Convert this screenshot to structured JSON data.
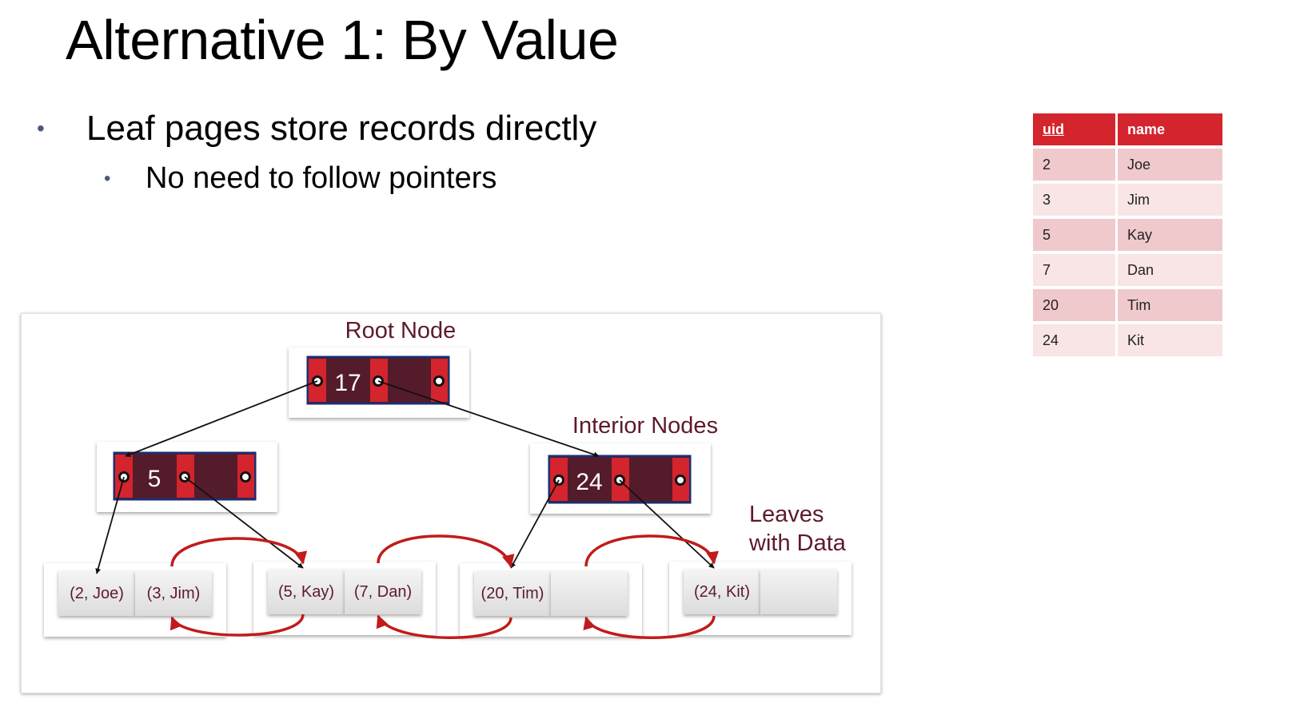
{
  "title": "Alternative 1: By Value",
  "bullets": {
    "level1": "Leaf pages store records directly",
    "level2": "No need to follow pointers",
    "marker": "•"
  },
  "table": {
    "columns": [
      "uid",
      "name"
    ],
    "rows": [
      [
        "2",
        "Joe"
      ],
      [
        "3",
        "Jim"
      ],
      [
        "5",
        "Kay"
      ],
      [
        "7",
        "Dan"
      ],
      [
        "20",
        "Tim"
      ],
      [
        "24",
        "Kit"
      ]
    ]
  },
  "diagram": {
    "labels": {
      "root": "Root Node",
      "interior": "Interior Nodes",
      "leaves_line1": "Leaves",
      "leaves_line2": "with Data"
    },
    "root_key": "17",
    "interior_keys": [
      "5",
      "24"
    ],
    "leaves": [
      [
        "(2, Joe)",
        "(3, Jim)"
      ],
      [
        "(5, Kay)",
        "(7, Dan)"
      ],
      [
        "(20, Tim)",
        ""
      ],
      [
        "(24, Kit)",
        ""
      ]
    ]
  },
  "colors": {
    "node_fill": "#541b2b",
    "node_stripe": "#d4242d",
    "node_border": "#1e2e6e",
    "label": "#5e1a2a",
    "sibling_link": "#c11b1b",
    "table_header": "#d4242d"
  }
}
